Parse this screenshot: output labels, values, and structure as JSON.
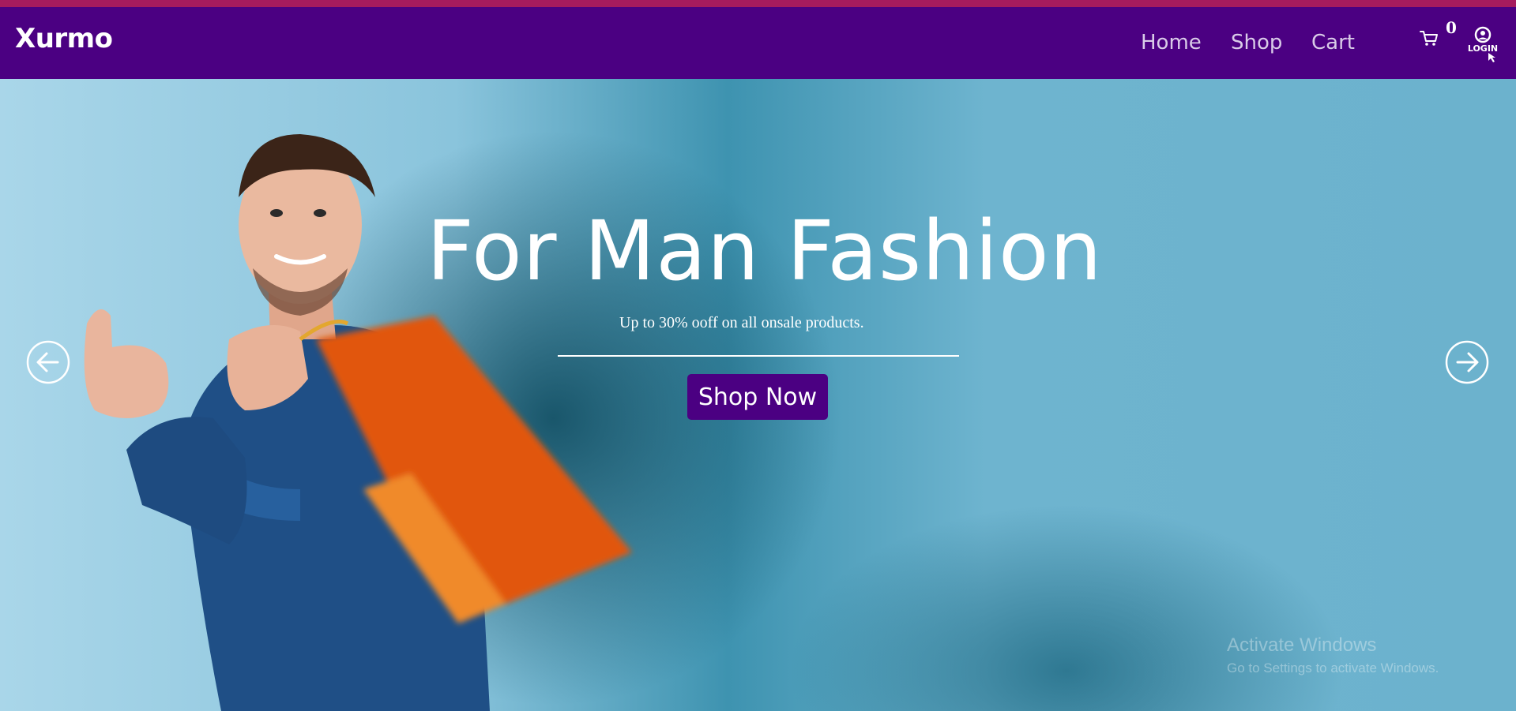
{
  "navbar": {
    "brand": "Xurmo",
    "links": [
      "Home",
      "Shop",
      "Cart"
    ],
    "cart_count": "0",
    "login_label": "LOGIN"
  },
  "hero": {
    "title": "For Man Fashion",
    "subtitle": "Up to 30% ooff on all onsale products.",
    "cta_label": "Shop Now"
  },
  "watermark": {
    "title": "Activate Windows",
    "subtitle": "Go to Settings to activate Windows."
  },
  "colors": {
    "navbar_bg": "#4b0082",
    "top_stripe": "#a61b5e",
    "cta_bg": "#4b0082",
    "hero_bg": "#6cb2cd"
  },
  "icons": {
    "cart": "cart-icon",
    "login": "login-icon",
    "prev": "arrow-left-icon",
    "next": "arrow-right-icon"
  }
}
